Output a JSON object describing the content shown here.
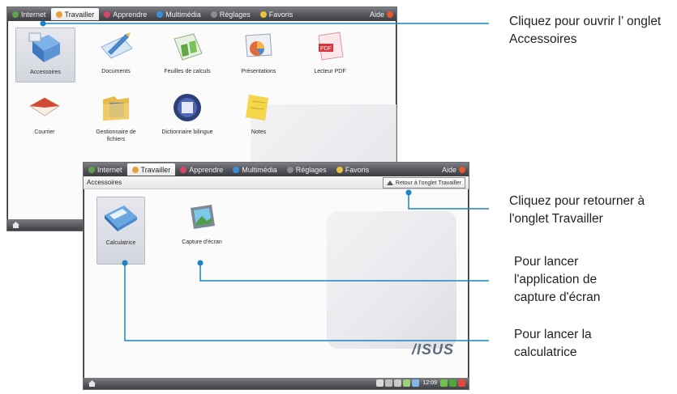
{
  "screen1": {
    "tabs": [
      {
        "label": "Internet",
        "color": "#5ea24a"
      },
      {
        "label": "Travailler",
        "color": "#e9a23b",
        "active": true
      },
      {
        "label": "Apprendre",
        "color": "#d8466a"
      },
      {
        "label": "Multimédia",
        "color": "#3b8fd6"
      },
      {
        "label": "Réglages",
        "color": "#8c8c94"
      },
      {
        "label": "Favoris",
        "color": "#e9c43b"
      }
    ],
    "help": "Aide",
    "apps": [
      {
        "label": "Accessoires",
        "icon": "accessories-icon"
      },
      {
        "label": "Documents",
        "icon": "documents-icon"
      },
      {
        "label": "Feuilles de calculs",
        "icon": "spreadsheets-icon"
      },
      {
        "label": "Présentations",
        "icon": "presentations-icon"
      },
      {
        "label": "Lecteur PDF",
        "icon": "pdf-reader-icon"
      },
      {
        "label": "Courrier",
        "icon": "mail-icon"
      },
      {
        "label": "Gestionnaire de fichiers",
        "icon": "file-manager-icon"
      },
      {
        "label": "Dictionnaire bilingue",
        "icon": "dictionary-icon"
      },
      {
        "label": "Notes",
        "icon": "notes-icon"
      }
    ]
  },
  "screen2": {
    "tabs": [
      {
        "label": "Internet",
        "color": "#5ea24a"
      },
      {
        "label": "Travailler",
        "color": "#e9a23b",
        "active": true
      },
      {
        "label": "Apprendre",
        "color": "#d8466a"
      },
      {
        "label": "Multimédia",
        "color": "#3b8fd6"
      },
      {
        "label": "Réglages",
        "color": "#8c8c94"
      },
      {
        "label": "Favoris",
        "color": "#e9c43b"
      }
    ],
    "help": "Aide",
    "breadcrumb": "Accessoires",
    "back_button": "Retour à l'onglet Travailler",
    "apps": [
      {
        "label": "Calculatrice",
        "icon": "calculator-icon"
      },
      {
        "label": "Capture d'écran",
        "icon": "screenshot-icon"
      }
    ],
    "brand": "/ISUS",
    "clock": "12:09"
  },
  "callouts": {
    "accessories": "Cliquez pour ouvrir l’ onglet Accessoires",
    "back": "Cliquez pour retourner à l'onglet Travailler",
    "screenshot": "Pour lancer l'application de capture d'écran",
    "calculator": "Pour lancer la calculatrice"
  }
}
